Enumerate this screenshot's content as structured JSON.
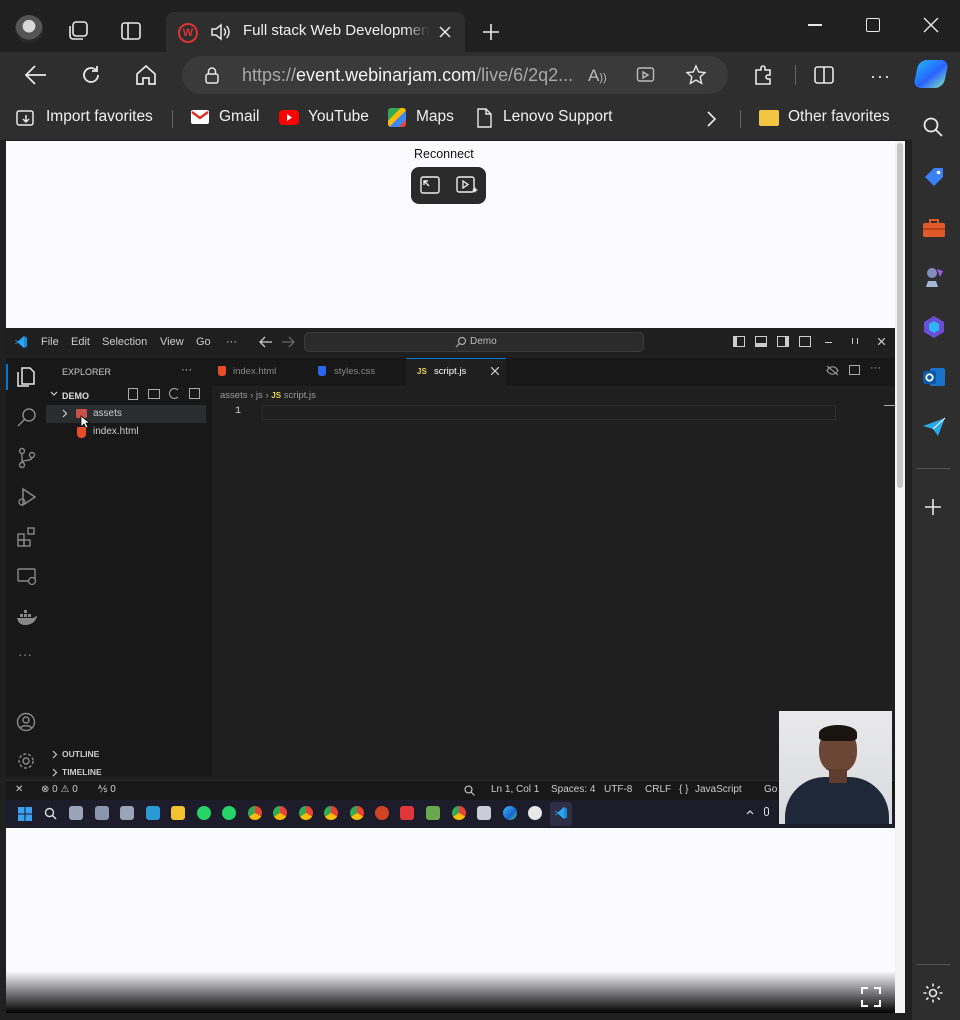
{
  "browser": {
    "tab_title": "Full stack Web Development",
    "url_prefix": "https://",
    "url_host": "event.webinarjam.com",
    "url_rest": "/live/6/2q2...",
    "favorites": [
      "Import favorites",
      "Gmail",
      "YouTube",
      "Maps",
      "Lenovo Support"
    ],
    "other_favorites": "Other favorites"
  },
  "webinar": {
    "reconnect_label": "Reconnect"
  },
  "vscode": {
    "menu": [
      "File",
      "Edit",
      "Selection",
      "View",
      "Go",
      "···"
    ],
    "search_placeholder": "Demo",
    "explorer_title": "EXPLORER",
    "explorer_more": "···",
    "folder_name": "DEMO",
    "tree": [
      "assets",
      "index.html"
    ],
    "tabs": [
      "index.html",
      "styles.css",
      "script.js"
    ],
    "breadcrumb": [
      "assets",
      "js",
      "script.js"
    ],
    "breadcrumb_js_badge": "JS",
    "tab_js_badge": "JS",
    "line_number": "1",
    "outline_label": "OUTLINE",
    "timeline_label": "TIMELINE",
    "status": {
      "problems": "⊗ 0 ⚠ 0",
      "ports": "⅍ 0",
      "cursor": "Ln 1, Col 1",
      "spaces": "Spaces: 4",
      "encoding": "UTF-8",
      "eol": "CRLF",
      "language": "JavaScript",
      "golive": "Go"
    }
  },
  "colors": {
    "browser_dark": "#202020",
    "toolbar": "#2e2e2e",
    "vscode_bg": "#1f1f1f",
    "vscode_accent": "#0078d4"
  }
}
